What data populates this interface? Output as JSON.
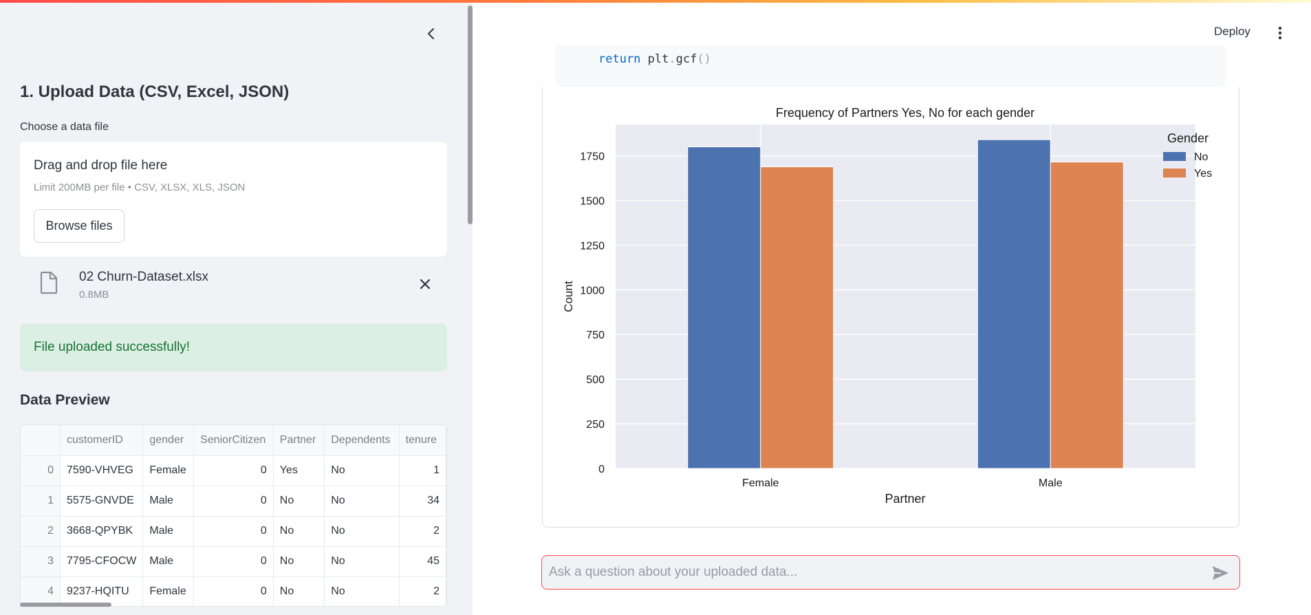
{
  "sidebar": {
    "upload_heading": "1. Upload Data (CSV, Excel, JSON)",
    "file_label": "Choose a data file",
    "dropzone": {
      "title": "Drag and drop file here",
      "limit": "Limit 200MB per file • CSV, XLSX, XLS, JSON",
      "browse_label": "Browse files"
    },
    "uploaded_file": {
      "name": "02 Churn-Dataset.xlsx",
      "size": "0.8MB"
    },
    "success_message": "File uploaded successfully!",
    "preview_heading": "Data Preview",
    "table": {
      "columns": [
        "",
        "customerID",
        "gender",
        "SeniorCitizen",
        "Partner",
        "Dependents",
        "tenure"
      ],
      "rows": [
        [
          "0",
          "7590-VHVEG",
          "Female",
          "0",
          "Yes",
          "No",
          "1"
        ],
        [
          "1",
          "5575-GNVDE",
          "Male",
          "0",
          "No",
          "No",
          "34"
        ],
        [
          "2",
          "3668-QPYBK",
          "Male",
          "0",
          "No",
          "No",
          "2"
        ],
        [
          "3",
          "7795-CFOCW",
          "Male",
          "0",
          "No",
          "No",
          "45"
        ],
        [
          "4",
          "9237-HQITU",
          "Female",
          "0",
          "No",
          "No",
          "2"
        ]
      ]
    }
  },
  "header": {
    "deploy_label": "Deploy"
  },
  "code": {
    "keyword": "return",
    "call": "plt",
    "dot": ".",
    "fn": "gcf",
    "paren": "()"
  },
  "chat": {
    "placeholder": "Ask a question about your uploaded data..."
  },
  "icons": {
    "collapse": "chevron-left-icon",
    "file": "file-icon",
    "close": "close-icon",
    "menu": "kebab-menu-icon",
    "send": "send-icon"
  },
  "colors": {
    "accent": "#ff4b4b",
    "series_no": "#4c72b0",
    "series_yes": "#dd8452",
    "success_text": "#177233",
    "success_bg": "#dcefe4"
  },
  "chart_data": {
    "type": "bar",
    "title": "Frequency of Partners Yes, No for each gender",
    "xlabel": "Partner",
    "ylabel": "Count",
    "categories": [
      "Female",
      "Male"
    ],
    "series": [
      {
        "name": "No",
        "values": [
          1800,
          1840
        ]
      },
      {
        "name": "Yes",
        "values": [
          1688,
          1715
        ]
      }
    ],
    "ylim": [
      0,
      1925
    ],
    "yticks": [
      0,
      250,
      500,
      750,
      1000,
      1250,
      1500,
      1750
    ],
    "legend_title": "Gender",
    "legend_position": "top-right",
    "grid": true
  }
}
